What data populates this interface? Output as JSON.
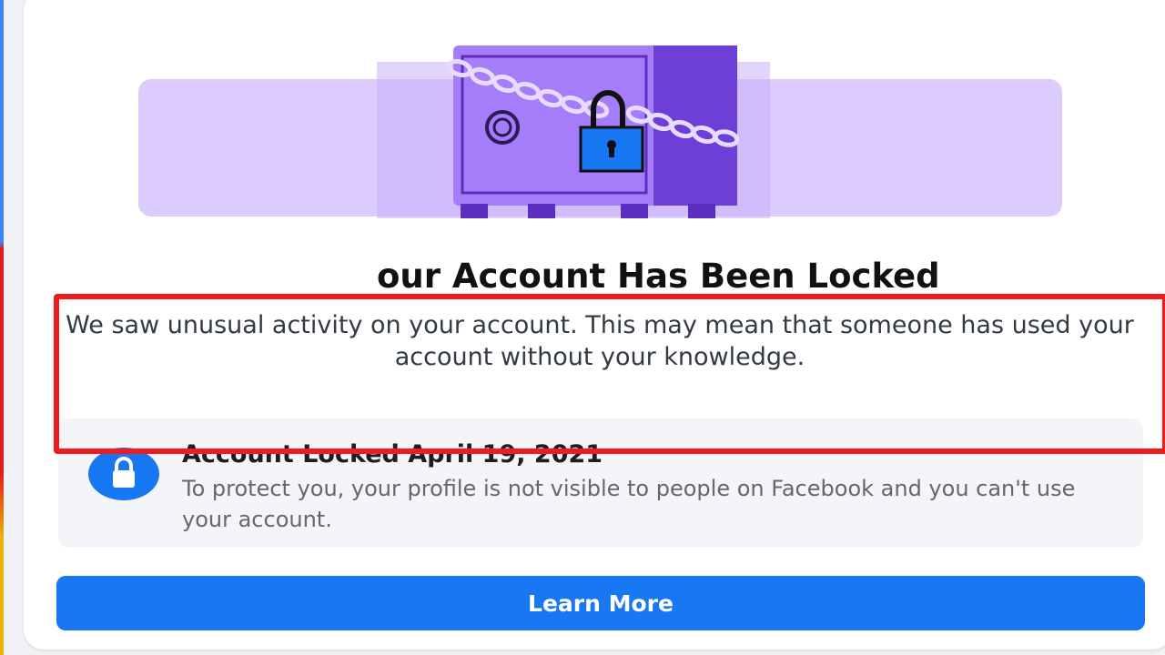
{
  "colors": {
    "brand_blue": "#1877f2",
    "banner_purple": "#dccbfd",
    "safe_purple": "#a57cf9",
    "safe_dark_purple": "#6d3fd6",
    "highlight_red": "#ee1c1c"
  },
  "illustration": {
    "icon": "locked-safe-icon"
  },
  "heading": {
    "title": "our Account Has Been Locked"
  },
  "message": {
    "text": "We saw unusual activity on your account. This may mean that someone has used your account without your knowledge."
  },
  "lock_notice": {
    "icon": "lock-icon",
    "title": "Account Locked April 19, 2021",
    "description": "To protect you, your profile is not visible to people on Facebook and you can't use your account."
  },
  "actions": {
    "learn_more_label": "Learn More"
  }
}
